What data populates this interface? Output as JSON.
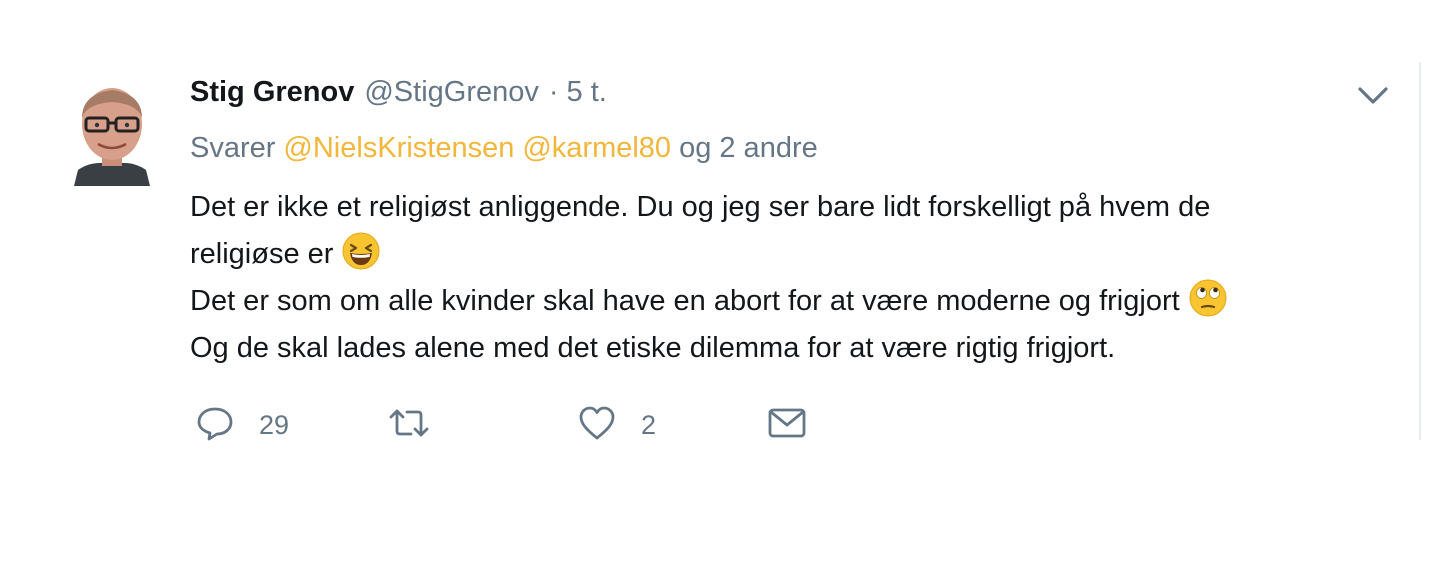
{
  "tweet": {
    "author_name": "Stig Grenov",
    "author_handle": "@StigGrenov",
    "separator": "·",
    "timestamp": "5 t.",
    "reply_prefix": "Svarer",
    "reply_mentions": [
      "@NielsKristensen",
      "@karmel80"
    ],
    "reply_suffix": "og 2 andre",
    "body_lines": [
      "Det er ikke et religiøst anliggende. Du og jeg ser bare lidt forskelligt på hvem de",
      "religiøse er",
      "Det er som om alle kvinder skal have en abort for at være moderne og frigjort",
      "Og de skal lades alene med det etiske dilemma for at være rigtig frigjort."
    ],
    "emojis": {
      "line2": "grinning-squinting-face-emoji",
      "line3": "face-with-rolling-eyes-emoji"
    },
    "actions": {
      "reply_count": "29",
      "retweet_count": "",
      "like_count": "2",
      "icons": [
        "reply-icon",
        "retweet-icon",
        "like-icon",
        "direct-message-icon"
      ]
    }
  },
  "colors": {
    "text_primary": "#14171a",
    "text_secondary": "#657786",
    "mention": "#f2b63a",
    "border": "#e6ecf0"
  }
}
